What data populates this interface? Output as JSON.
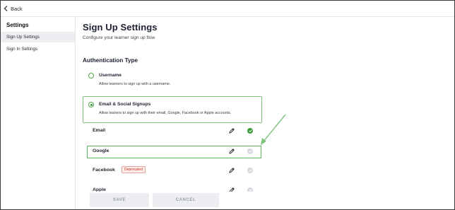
{
  "topbar": {
    "back_label": "Back"
  },
  "sidebar": {
    "title": "Settings",
    "items": [
      {
        "label": "Sign Up Settings",
        "active": true
      },
      {
        "label": "Sign In Settings",
        "active": false
      }
    ]
  },
  "main": {
    "title": "Sign Up Settings",
    "subtitle": "Configure your learner sign up flow",
    "section_title": "Authentication Type",
    "options": [
      {
        "label": "Username",
        "description": "Allow learners to sign up with a username.",
        "selected": false
      },
      {
        "label": "Email & Social Signups",
        "description": "Allow leaners to sign up with their email, Google, Facebook or Apple accounts.",
        "selected": true
      }
    ],
    "providers": [
      {
        "label": "Email",
        "enabled": true,
        "badge": ""
      },
      {
        "label": "Google",
        "enabled": false,
        "badge": ""
      },
      {
        "label": "Facebook",
        "enabled": false,
        "badge": "Deprecated"
      },
      {
        "label": "Apple",
        "enabled": false,
        "badge": ""
      }
    ]
  },
  "footer": {
    "save_label": "SAVE",
    "cancel_label": "CANCEL"
  },
  "colors": {
    "accent_green": "#3d9a3a",
    "highlight_green": "#5cb85c",
    "disabled_check": "#d4d7dc",
    "badge_red": "#c0392b"
  }
}
